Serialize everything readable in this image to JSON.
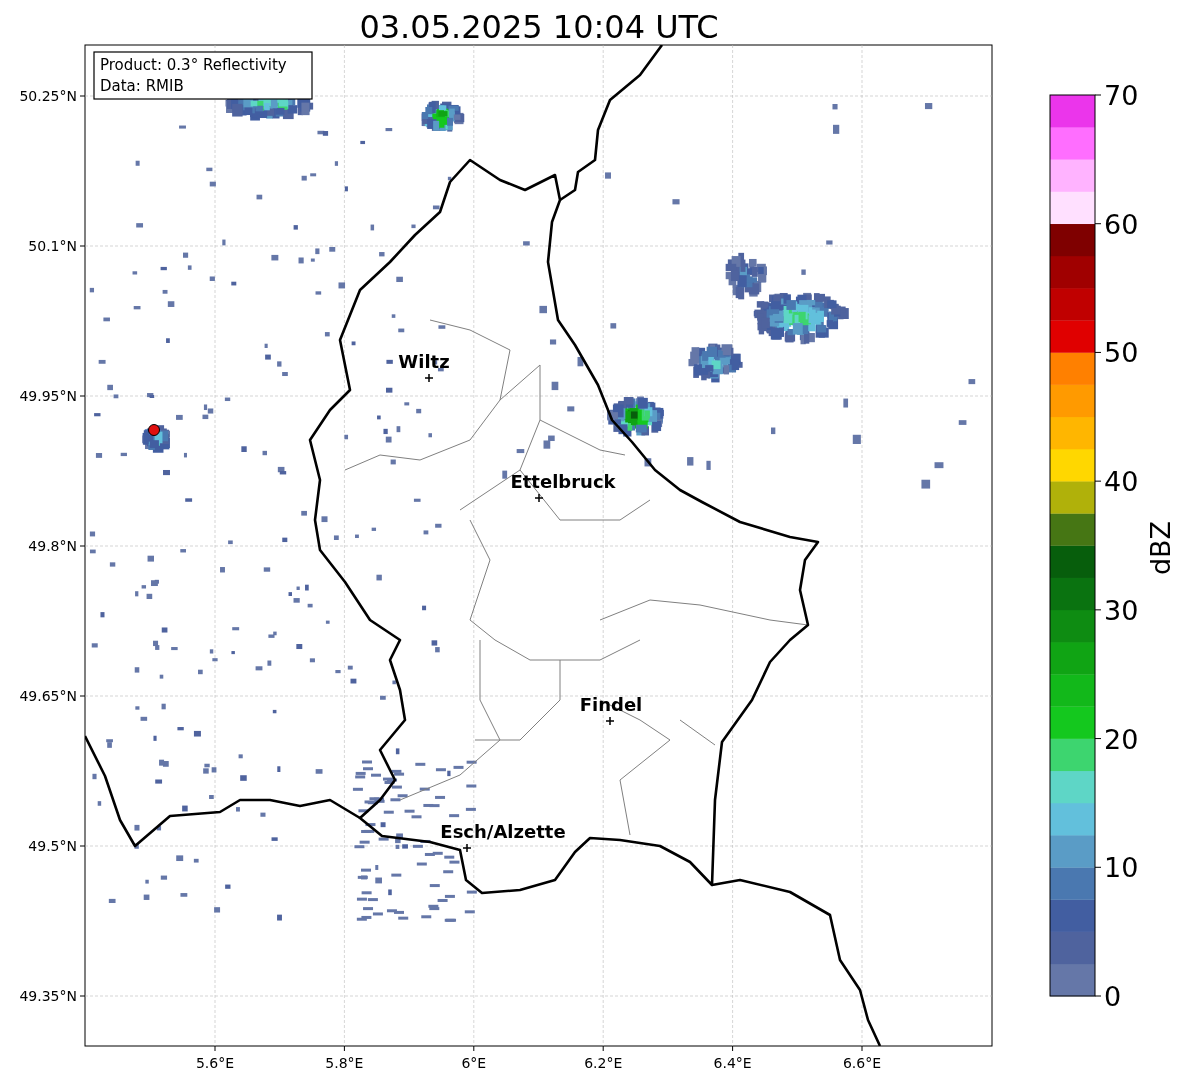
{
  "title": "03.05.2025 10:04 UTC",
  "info_box": [
    "Product: 0.3° Reflectivity",
    "Data: RMIB"
  ],
  "lat_labels": [
    "50.25°N",
    "50.1°N",
    "49.95°N",
    "49.8°N",
    "49.65°N",
    "49.5°N",
    "49.35°N"
  ],
  "lon_labels": [
    "5.6°E",
    "5.8°E",
    "6°E",
    "6.2°E",
    "6.4°E",
    "6.6°E"
  ],
  "cities": [
    {
      "name": "Wiltz"
    },
    {
      "name": "Ettelbruck"
    },
    {
      "name": "Findel"
    },
    {
      "name": "Esch/Alzette"
    }
  ],
  "colorbar": {
    "label": "dBZ",
    "ticks": [
      "70",
      "60",
      "50",
      "40",
      "30",
      "20",
      "10",
      "0"
    ],
    "segments": [
      {
        "color": "#6577a8"
      },
      {
        "color": "#4f639e"
      },
      {
        "color": "#425ea1"
      },
      {
        "color": "#4a78b0"
      },
      {
        "color": "#5a9cc6"
      },
      {
        "color": "#62c0dc"
      },
      {
        "color": "#5ed6c6"
      },
      {
        "color": "#3dd56f"
      },
      {
        "color": "#14c81e"
      },
      {
        "color": "#12b81a"
      },
      {
        "color": "#10a414"
      },
      {
        "color": "#0e8c12"
      },
      {
        "color": "#0a7310"
      },
      {
        "color": "#075e0c"
      },
      {
        "color": "#467614"
      },
      {
        "color": "#b0b10a"
      },
      {
        "color": "#ffd700"
      },
      {
        "color": "#ffb600"
      },
      {
        "color": "#ff9a00"
      },
      {
        "color": "#ff8000"
      },
      {
        "color": "#e00000"
      },
      {
        "color": "#c00000"
      },
      {
        "color": "#a00000"
      },
      {
        "color": "#7f0000"
      },
      {
        "color": "#ffe0ff"
      },
      {
        "color": "#ffb3ff"
      },
      {
        "color": "#ff6eff"
      },
      {
        "color": "#eb35eb"
      }
    ]
  }
}
